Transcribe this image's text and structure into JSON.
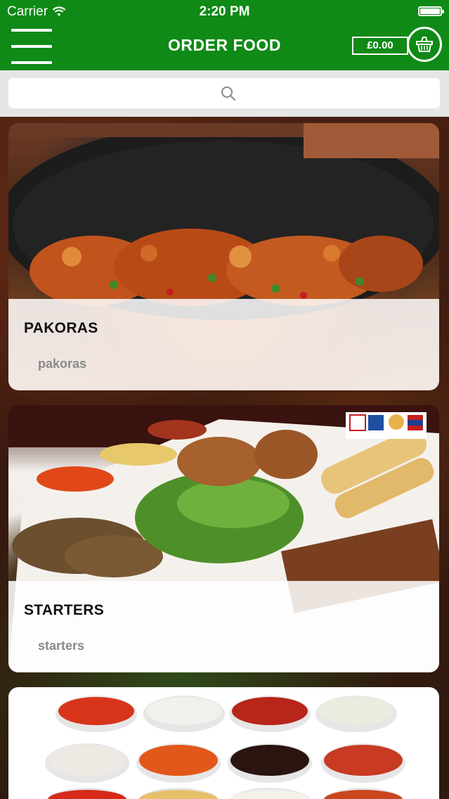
{
  "status_bar": {
    "carrier": "Carrier",
    "time": "2:20 PM"
  },
  "nav": {
    "title": "ORDER FOOD",
    "cart_total": "£0.00"
  },
  "search": {
    "placeholder": ""
  },
  "categories": [
    {
      "title": "PAKORAS",
      "subtitle": "pakoras"
    },
    {
      "title": "STARTERS",
      "subtitle": "starters"
    },
    {
      "title": "",
      "subtitle": ""
    }
  ],
  "colors": {
    "nav_green": "#0f8a16",
    "search_bg": "#e6e6e6"
  },
  "icons": [
    "menu-icon",
    "wifi-icon",
    "battery-icon",
    "basket-icon",
    "search-icon"
  ]
}
